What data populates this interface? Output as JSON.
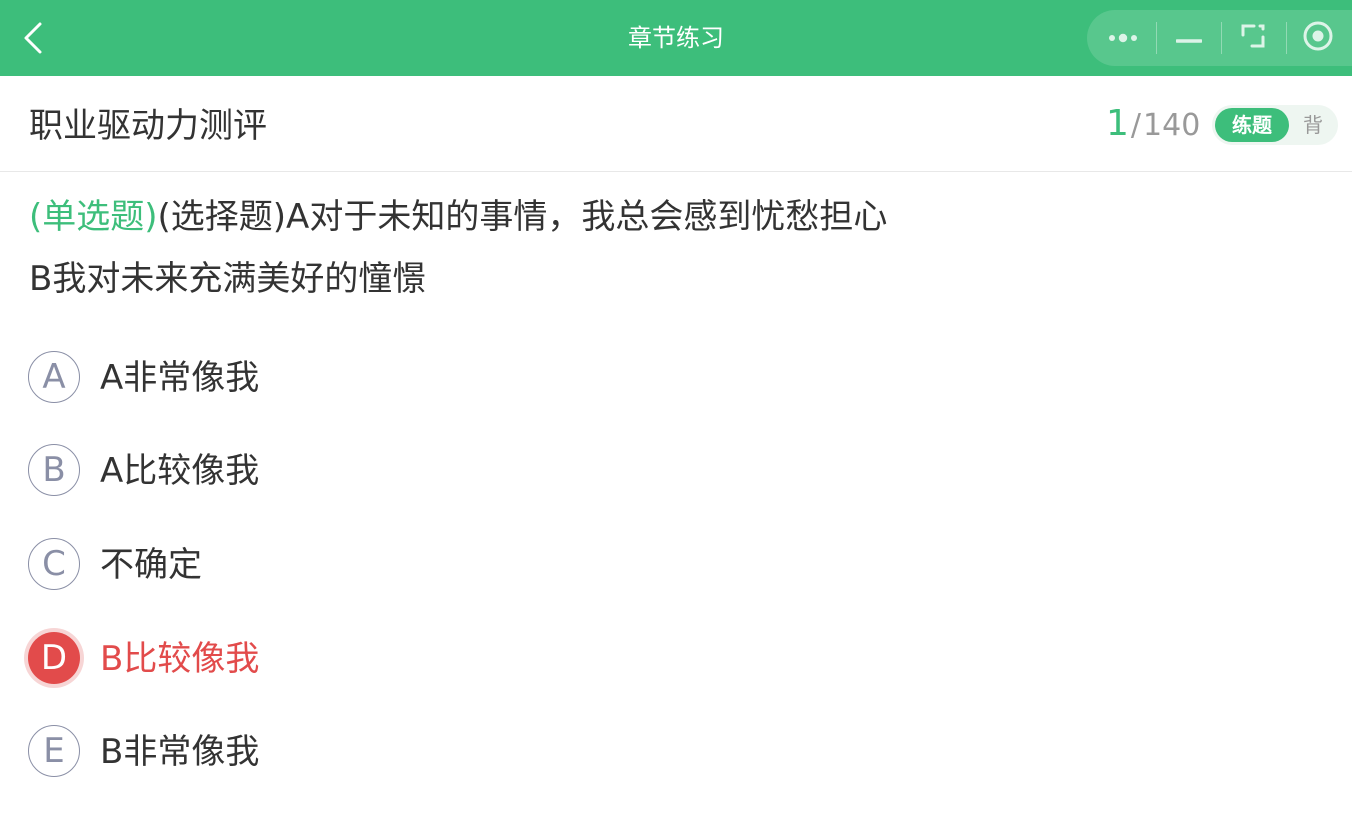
{
  "topbar": {
    "title": "章节练习",
    "back_icon": "chevron-left-icon",
    "capsule_icons": [
      "more-dots-icon",
      "minimize-icon",
      "restore-icon",
      "close-target-icon"
    ]
  },
  "header": {
    "title": "职业驱动力测评",
    "current": "1",
    "separator": "/",
    "total": "140",
    "mode_practice": "练题",
    "mode_memorize": "背"
  },
  "question": {
    "type_label": "(单选题)",
    "text_line1": "(选择题)A对于未知的事情，我总会感到忧愁担心",
    "text_line2": "B我对未来充满美好的憧憬"
  },
  "options": [
    {
      "letter": "A",
      "text": "A非常像我",
      "selected": false
    },
    {
      "letter": "B",
      "text": "A比较像我",
      "selected": false
    },
    {
      "letter": "C",
      "text": "不确定",
      "selected": false
    },
    {
      "letter": "D",
      "text": "B比较像我",
      "selected": true
    },
    {
      "letter": "E",
      "text": "B非常像我",
      "selected": false
    }
  ],
  "colors": {
    "brand_green": "#3dbe7b",
    "selected_red": "#e24b4b",
    "text": "#333333",
    "muted": "#999999"
  }
}
